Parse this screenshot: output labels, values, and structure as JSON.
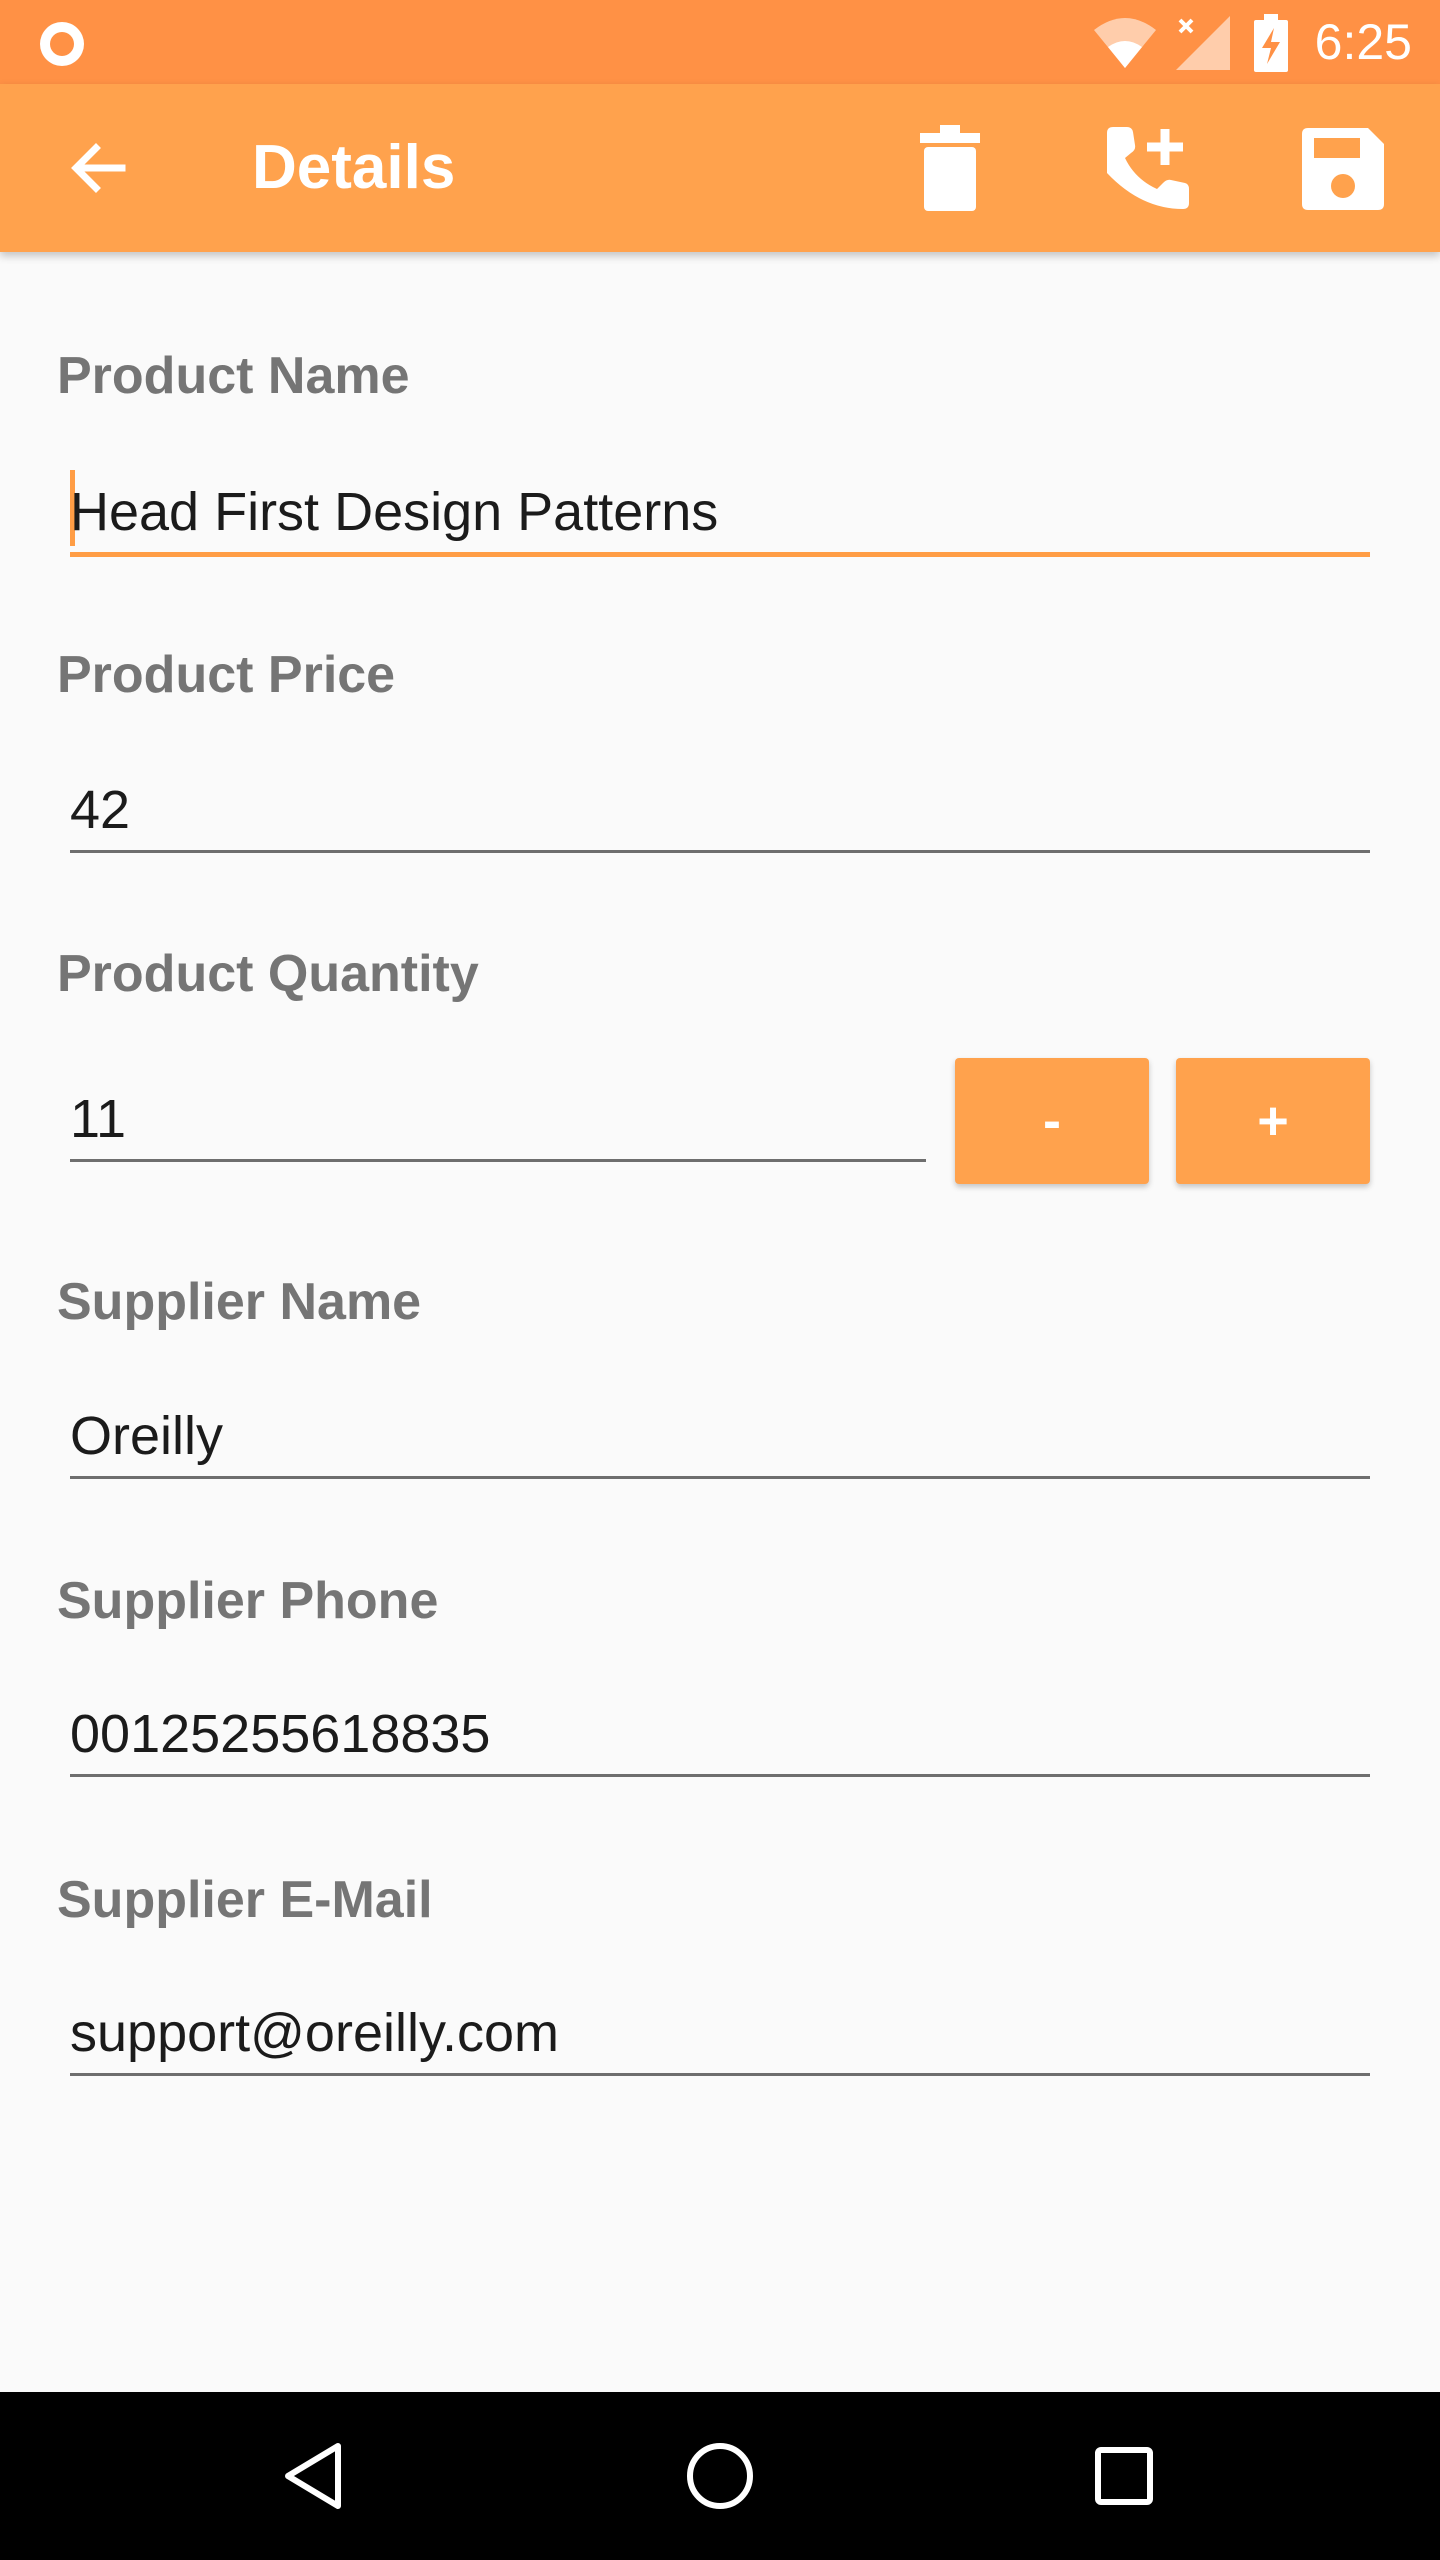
{
  "status_bar": {
    "time": "6:25",
    "icons": [
      "notification-dot-icon",
      "wifi-icon",
      "signal-icon",
      "battery-charging-icon"
    ]
  },
  "app_bar": {
    "title": "Details",
    "back_icon": "arrow-back-icon",
    "actions": [
      "delete-icon",
      "add-call-icon",
      "save-icon"
    ]
  },
  "form": {
    "product_name": {
      "label": "Product Name",
      "value": "Head First Design Patterns"
    },
    "product_price": {
      "label": "Product Price",
      "value": "42"
    },
    "product_quantity": {
      "label": "Product Quantity",
      "value": "11",
      "decrement_label": "-",
      "increment_label": "+"
    },
    "supplier_name": {
      "label": "Supplier Name",
      "value": "Oreilly"
    },
    "supplier_phone": {
      "label": "Supplier Phone",
      "value": "00125255618835"
    },
    "supplier_email": {
      "label": "Supplier E-Mail",
      "value": "support@oreilly.com"
    }
  },
  "nav_bar": {
    "icons": [
      "back-triangle-icon",
      "home-circle-icon",
      "recents-square-icon"
    ]
  },
  "colors": {
    "status_bar": "#ff9145",
    "accent": "#ffa24d",
    "label": "#757575",
    "text": "#1b1b1b"
  }
}
